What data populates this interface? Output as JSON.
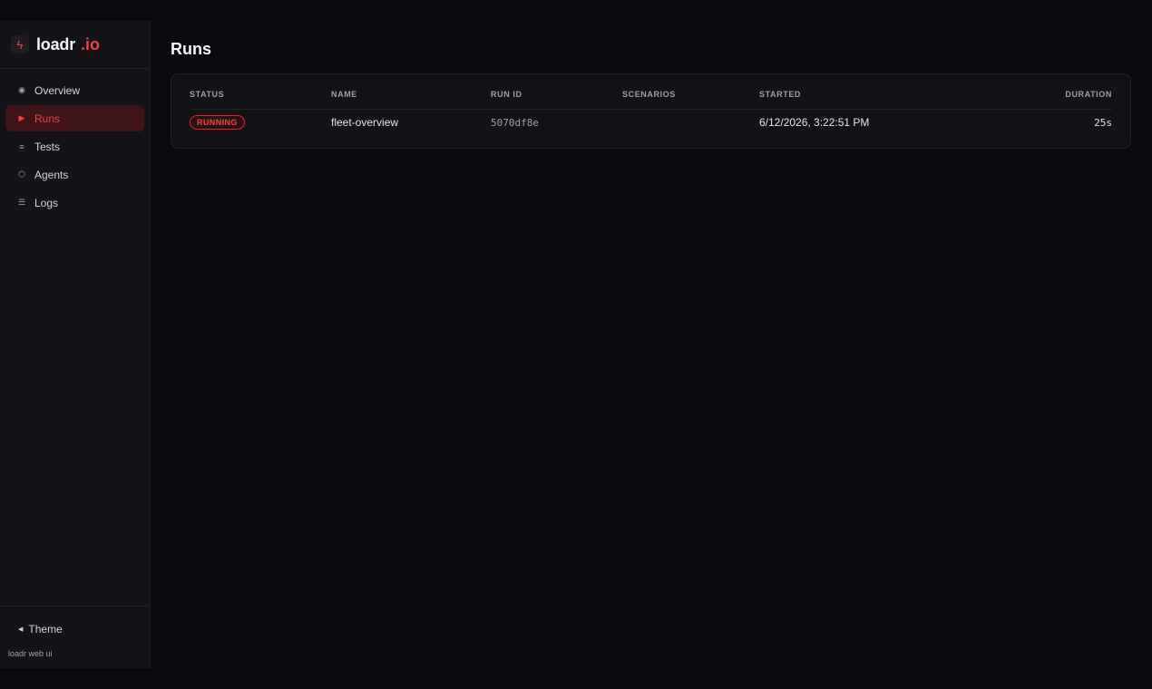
{
  "brand": {
    "name": "loadr",
    "tld": ".io",
    "mark_icon": "bolt-icon"
  },
  "nav": {
    "items": [
      {
        "label": "Overview",
        "icon": "overview-icon",
        "glyph": "◉",
        "active": false
      },
      {
        "label": "Runs",
        "icon": "play-icon",
        "glyph": "▶",
        "active": true
      },
      {
        "label": "Tests",
        "icon": "tests-icon",
        "glyph": "≡",
        "active": false
      },
      {
        "label": "Agents",
        "icon": "hexagon-icon",
        "glyph": "⬡",
        "active": false
      },
      {
        "label": "Logs",
        "icon": "logs-icon",
        "glyph": "☰",
        "active": false
      }
    ]
  },
  "footer": {
    "theme_label": "Theme",
    "note": "loadr web ui"
  },
  "page": {
    "title": "Runs"
  },
  "table": {
    "headers": {
      "status": "STATUS",
      "name": "NAME",
      "run_id": "RUN ID",
      "scenarios": "SCENARIOS",
      "started": "STARTED",
      "duration": "DURATION"
    },
    "rows": [
      {
        "status": "RUNNING",
        "name": "fleet-overview",
        "run_id": "5070df8e",
        "scenarios": "",
        "started": "6/12/2026, 3:22:51 PM",
        "duration": "25s"
      }
    ]
  },
  "colors": {
    "accent": "#ef4444",
    "background": "#0b0a0f",
    "sidebar": "#141318",
    "active_nav_bg": "#3f1418"
  }
}
